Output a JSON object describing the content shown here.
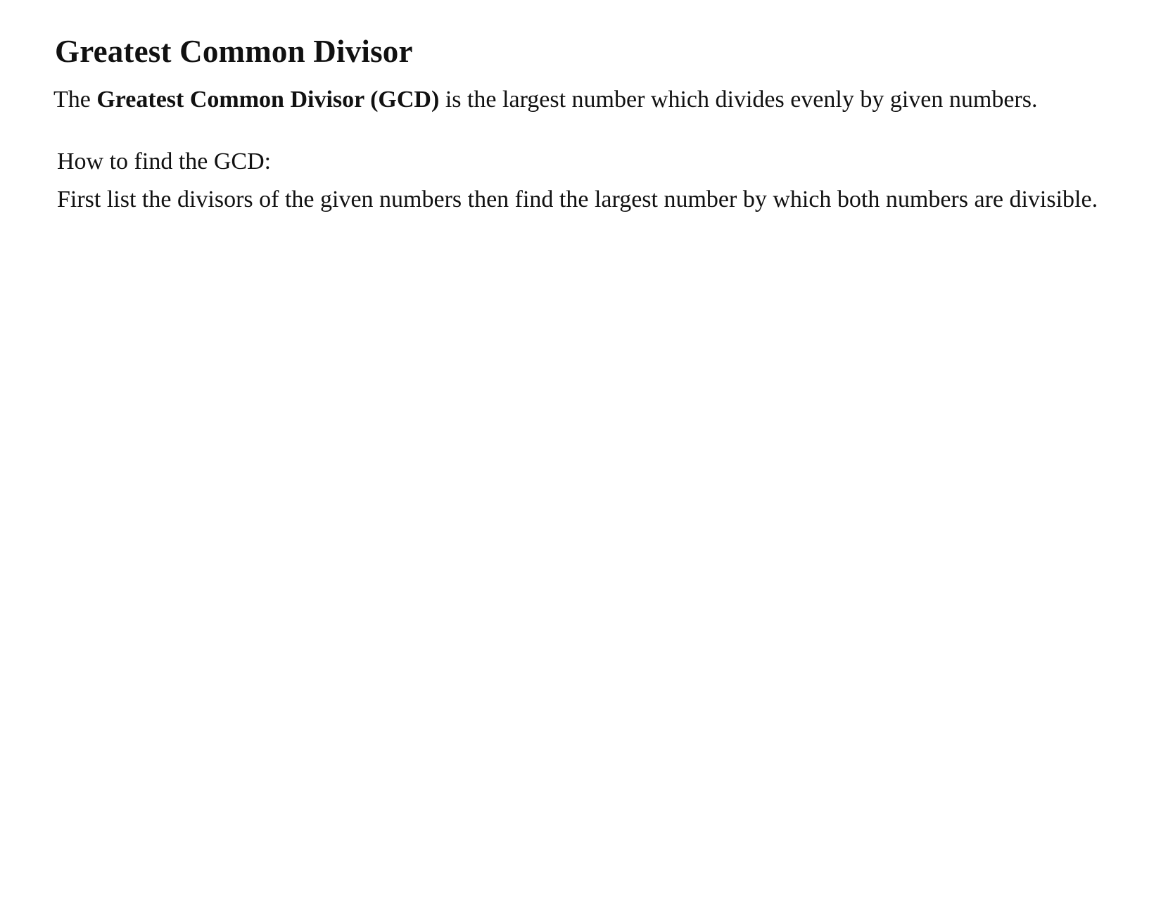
{
  "document": {
    "title": "Greatest Common Divisor",
    "definition": {
      "prefix": "The ",
      "term": "Greatest Common Divisor (GCD)",
      "suffix": " is the largest number which divides evenly by given numbers."
    },
    "how_to": {
      "heading": "How to find the GCD:",
      "body": "First list the divisors of the given numbers then find the largest number by which both numbers are divisible."
    }
  }
}
